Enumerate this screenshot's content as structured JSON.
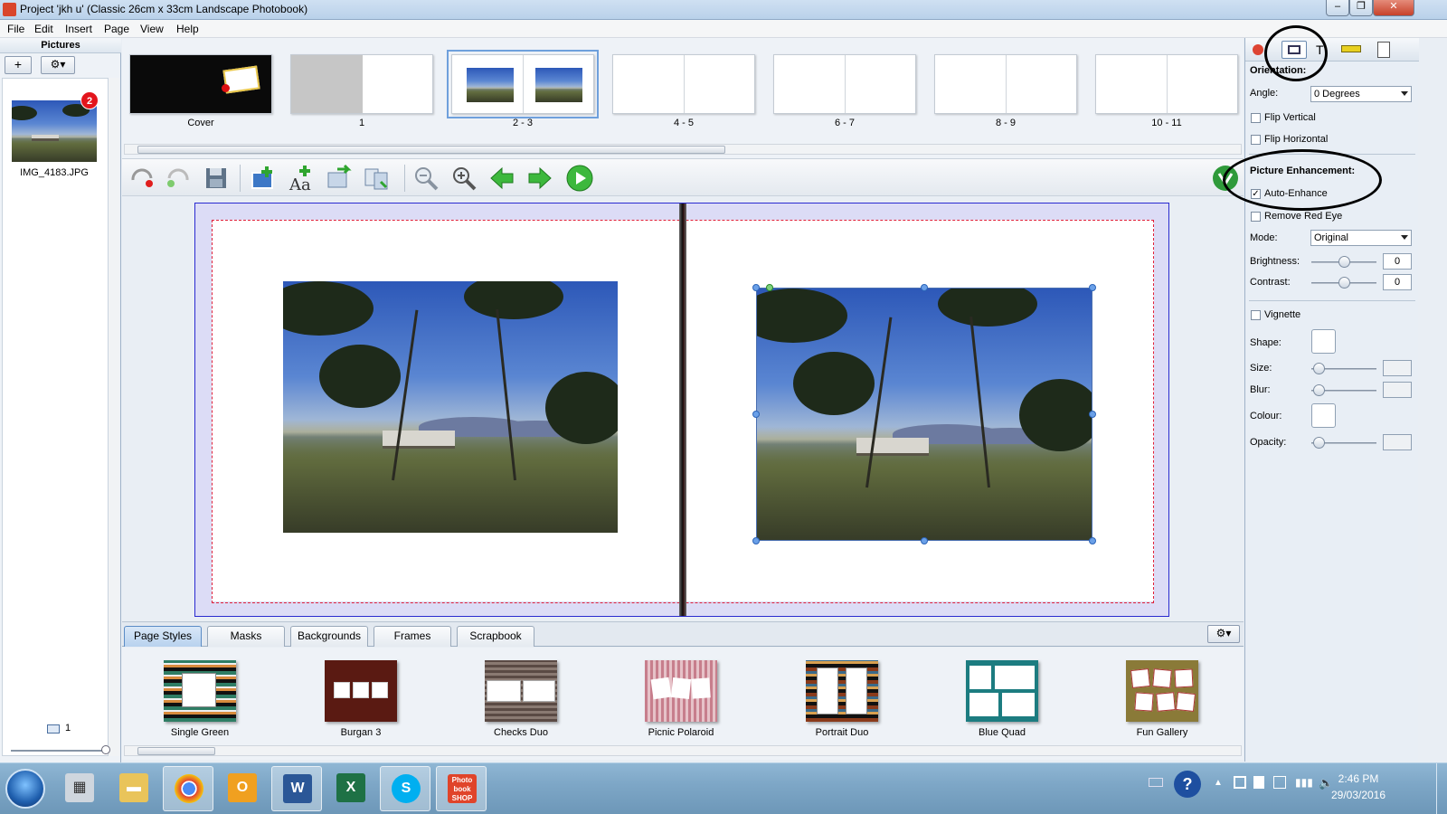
{
  "window": {
    "title": "Project 'jkh u' (Classic 26cm x 33cm Landscape Photobook)",
    "controls": [
      "minimize",
      "restore",
      "close"
    ]
  },
  "menu": [
    "File",
    "Edit",
    "Insert",
    "Page",
    "View",
    "Help"
  ],
  "pictures_panel": {
    "header": "Pictures",
    "add_label": "+",
    "gear_label": "⚙▾",
    "items": [
      {
        "filename": "IMG_4183.JPG",
        "badge": "2"
      }
    ],
    "page_counter": "1"
  },
  "page_strip": {
    "spreads": [
      {
        "label": "Cover"
      },
      {
        "label": "1"
      },
      {
        "label": "2 - 3",
        "selected": true
      },
      {
        "label": "4 - 5"
      },
      {
        "label": "6 - 7"
      },
      {
        "label": "8 - 9"
      },
      {
        "label": "10 - 11"
      }
    ]
  },
  "toolbar": {
    "icons": [
      "undo-icon",
      "redo-icon",
      "save-icon",
      "add-picture-icon",
      "add-text-icon",
      "replace-icon",
      "shuffle-icon",
      "zoom-out-icon",
      "zoom-in-icon",
      "prev-page-icon",
      "next-page-icon",
      "play-icon",
      "order-icon"
    ]
  },
  "bottom_tabs": [
    "Page Styles",
    "Masks",
    "Backgrounds",
    "Frames",
    "Scrapbook"
  ],
  "styles": [
    {
      "label": "Single Green"
    },
    {
      "label": "Burgan 3"
    },
    {
      "label": "Checks Duo"
    },
    {
      "label": "Picnic Polaroid"
    },
    {
      "label": "Portrait Duo"
    },
    {
      "label": "Blue Quad"
    },
    {
      "label": "Fun Gallery"
    }
  ],
  "properties": {
    "orientation_header": "Orientation:",
    "angle_label": "Angle:",
    "angle_value": "0 Degrees",
    "flip_vertical": "Flip Vertical",
    "flip_horizontal": "Flip Horizontal",
    "enhancement_header": "Picture Enhancement:",
    "auto_enhance": "Auto-Enhance",
    "auto_enhance_checked": true,
    "remove_red_eye": "Remove Red Eye",
    "mode_label": "Mode:",
    "mode_value": "Original",
    "brightness_label": "Brightness:",
    "brightness_value": "0",
    "contrast_label": "Contrast:",
    "contrast_value": "0",
    "vignette": "Vignette",
    "shape_label": "Shape:",
    "size_label": "Size:",
    "blur_label": "Blur:",
    "colour_label": "Colour:",
    "opacity_label": "Opacity:"
  },
  "taskbar": {
    "time": "2:46 PM",
    "date": "29/03/2016",
    "apps": [
      "calculator",
      "file-explorer",
      "chrome",
      "outlook",
      "word",
      "excel",
      "skype",
      "photobook-shop"
    ],
    "photobook_label": "Photo book SHOP"
  },
  "colors": {
    "accent_blue": "#5b8cc6",
    "safe_line": "#e0203a",
    "bleed": "#dcdcf6",
    "badge_red": "#e3151c"
  }
}
